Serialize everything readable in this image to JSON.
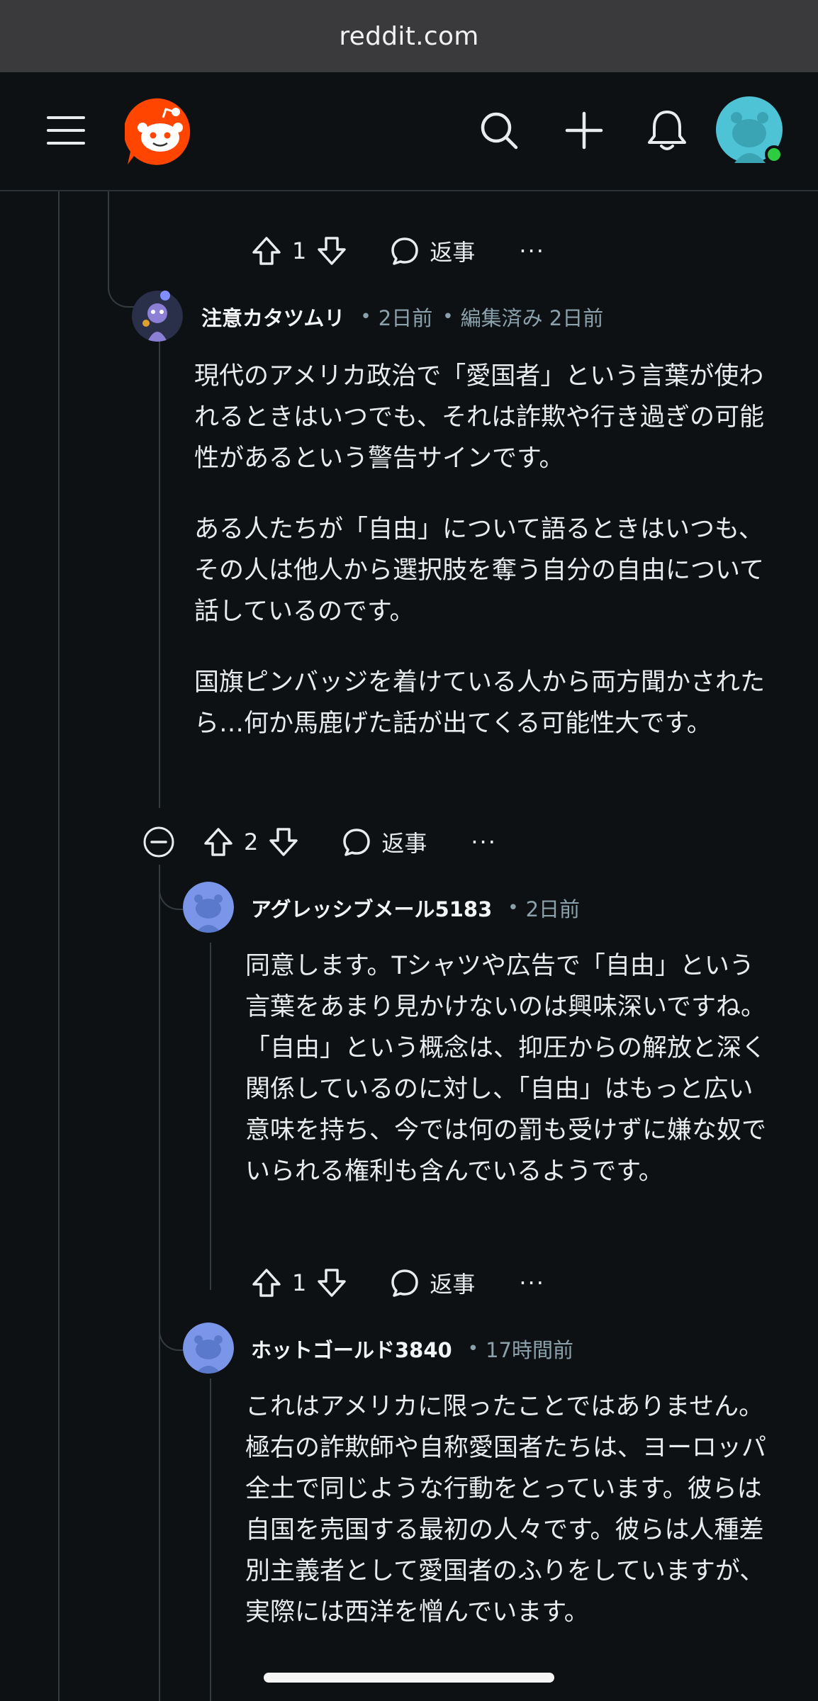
{
  "browser": {
    "url": "reddit.com"
  },
  "header": {
    "menu_icon": "hamburger-menu-icon",
    "logo_icon": "reddit-snoo-logo",
    "search_icon": "search-icon",
    "create_icon": "plus-icon",
    "notifications_icon": "bell-icon",
    "avatar_status": "online"
  },
  "top_actions": {
    "upvotes": "1",
    "reply_label": "返事",
    "more": "···"
  },
  "comments": [
    {
      "username": "注意カタツムリ",
      "time": "2日前",
      "edited_label": "編集済み 2日前",
      "paragraphs": [
        "現代のアメリカ政治で「愛国者」という言葉が使われるときはいつでも、それは詐欺や行き過ぎの可能性があるという警告サインです。",
        "ある人たちが「自由」について語るときはいつも、その人は他人から選択肢を奪う自分の自由について話しているのです。",
        "国旗ピンバッジを着けている人から両方聞かされたら…何か馬鹿げた話が出てくる可能性大です。"
      ],
      "upvotes": "2",
      "reply_label": "返事",
      "more": "···"
    },
    {
      "username": "アグレッシブメール5183",
      "time": "2日前",
      "paragraphs": [
        "同意します。Tシャツや広告で「自由」という言葉をあまり見かけないのは興味深いですね。「自由」という概念は、抑圧からの解放と深く関係しているのに対し、「自由」はもっと広い意味を持ち、今では何の罰も受けずに嫌な奴でいられる権利も含んでいるようです。"
      ],
      "upvotes": "1",
      "reply_label": "返事",
      "more": "···"
    },
    {
      "username": "ホットゴールド3840",
      "time": "17時間前",
      "paragraphs": [
        "これはアメリカに限ったことではありません。極右の詐欺師や自称愛国者たちは、ヨーロッパ全土で同じような行動をとっています。彼らは自国を売国する最初の人々です。彼らは人種差別主義者として愛国者のふりをしていますが、実際には西洋を憎んでいます。"
      ]
    }
  ],
  "colors": {
    "background": "#0e1113",
    "reddit_orange": "#ff4500",
    "meta_text": "#8ba2ad",
    "thread_line": "#343c40",
    "online_dot": "#2ecc40"
  }
}
